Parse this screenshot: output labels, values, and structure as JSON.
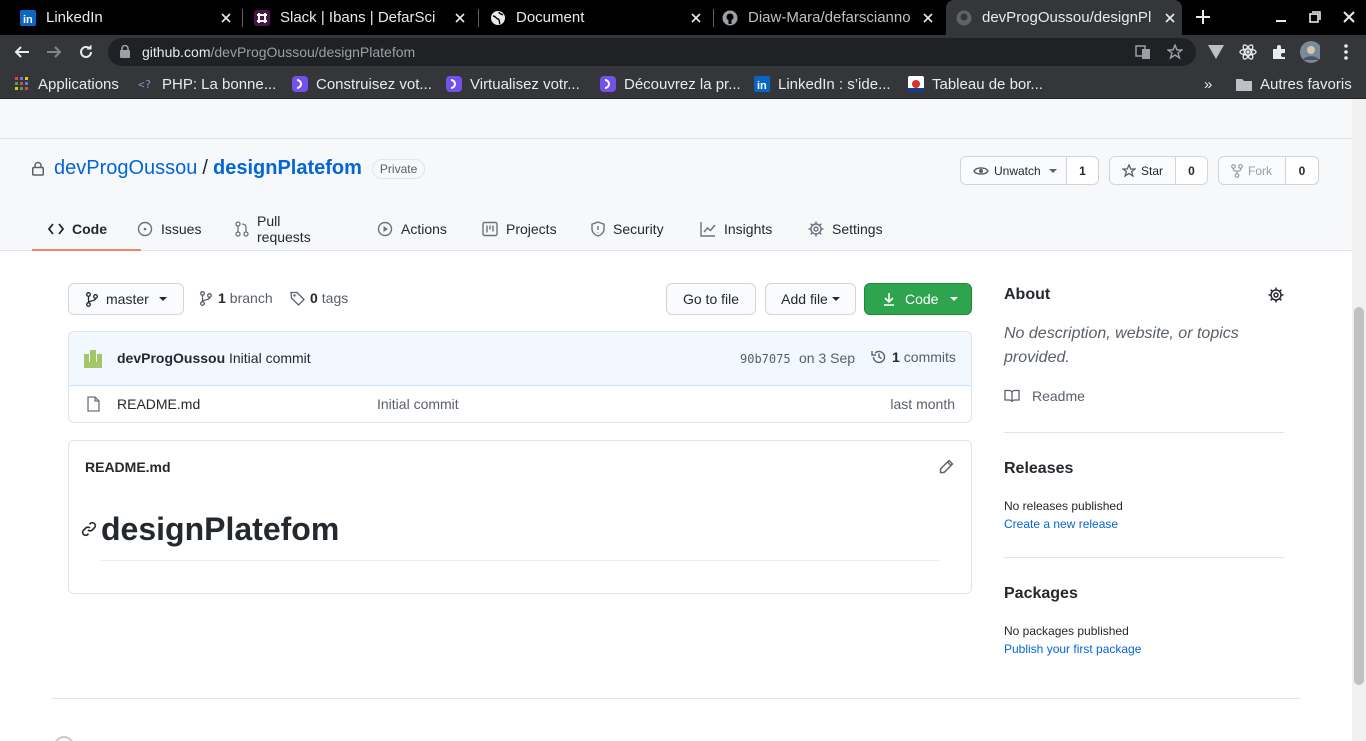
{
  "browser": {
    "tabs": [
      {
        "title": "LinkedIn",
        "favicon": "linkedin-icon"
      },
      {
        "title": "Slack | Ibans | DefarSci",
        "favicon": "slack-icon"
      },
      {
        "title": "Document",
        "favicon": "globe-icon"
      },
      {
        "title": "Diaw-Mara/defarscianno",
        "favicon": "github-icon"
      },
      {
        "title": "devProgOussou/designPl",
        "favicon": "github-icon",
        "active": true
      }
    ],
    "url_host": "github.com",
    "url_path": "/devProgOussou/designPlatefom",
    "bookmarks": [
      {
        "label": "Applications",
        "favicon": "apps-grid-icon"
      },
      {
        "label": "PHP: La bonne...",
        "favicon": "php-icon"
      },
      {
        "label": "Construisez vot...",
        "favicon": "openclassrooms-icon"
      },
      {
        "label": "Virtualisez votr...",
        "favicon": "openclassrooms-icon"
      },
      {
        "label": "Découvrez la pr...",
        "favicon": "openclassrooms-icon"
      },
      {
        "label": "LinkedIn : s’ide...",
        "favicon": "linkedin-icon"
      },
      {
        "label": "Tableau de bor...",
        "favicon": "dashboard-icon"
      }
    ],
    "overflow_label": "»",
    "other_bookmarks": "Autres favoris"
  },
  "repo": {
    "owner": "devProgOussou",
    "separator": "/",
    "name": "designPlatefom",
    "visibility": "Private",
    "watch_label": "Unwatch",
    "watch_count": "1",
    "star_label": "Star",
    "star_count": "0",
    "fork_label": "Fork",
    "fork_count": "0"
  },
  "nav": {
    "tabs": [
      {
        "label": "Code",
        "icon": "code-icon",
        "selected": true
      },
      {
        "label": "Issues",
        "icon": "issue-icon"
      },
      {
        "label": "Pull requests",
        "icon": "pull-request-icon"
      },
      {
        "label": "Actions",
        "icon": "play-icon"
      },
      {
        "label": "Projects",
        "icon": "project-icon"
      },
      {
        "label": "Security",
        "icon": "shield-icon"
      },
      {
        "label": "Insights",
        "icon": "graph-icon"
      },
      {
        "label": "Settings",
        "icon": "gear-icon"
      }
    ]
  },
  "toolbar": {
    "branch": "master",
    "branch_count": "1",
    "branch_label": "branch",
    "tag_count": "0",
    "tag_label": "tags",
    "go_to_file": "Go to file",
    "add_file": "Add file",
    "code": "Code"
  },
  "commit": {
    "author": "devProgOussou",
    "message": "Initial commit",
    "sha": "90b7075",
    "date": "on 3 Sep",
    "count": "1",
    "count_label": "commits"
  },
  "files": [
    {
      "name": "README.md",
      "message": "Initial commit",
      "age": "last month"
    }
  ],
  "readme": {
    "filename": "README.md",
    "heading": "designPlatefom"
  },
  "about": {
    "title": "About",
    "description": "No description, website, or topics provided.",
    "readme_label": "Readme",
    "releases_title": "Releases",
    "releases_text": "No releases published",
    "releases_link": "Create a new release",
    "packages_title": "Packages",
    "packages_text": "No packages published",
    "packages_link": "Publish your first package"
  },
  "colors": {
    "link": "#0366d6",
    "green_button": "#2ea44f",
    "selected_tab_underline": "#f9826c"
  }
}
